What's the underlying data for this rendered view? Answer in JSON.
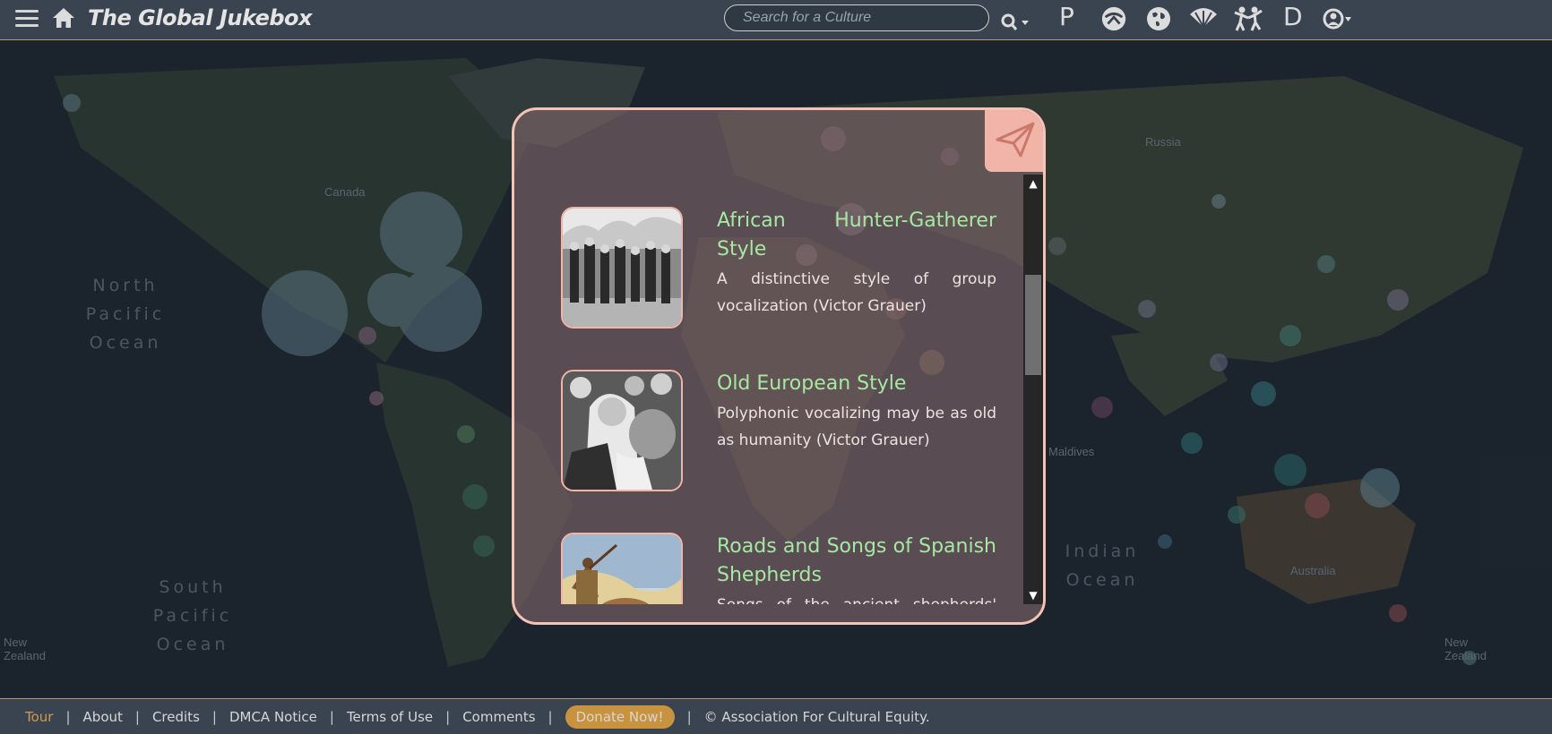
{
  "header": {
    "title": "The Global Jukebox",
    "search_placeholder": "Search for a Culture",
    "icons": [
      "menu-icon",
      "home-icon",
      "search-icon",
      "letter-p",
      "parlametrics-icon",
      "globe-icon",
      "fan-icon",
      "dancers-icon",
      "letter-d",
      "account-icon"
    ],
    "letter_p": "P",
    "letter_d": "D"
  },
  "map": {
    "ocean_labels": [
      "North Pacific Ocean",
      "South Pacific Ocean",
      "Indian Ocean"
    ],
    "places": [
      "Canada",
      "Russia",
      "Maldives",
      "Australia",
      "New Zealand",
      "New Zealand"
    ]
  },
  "modal": {
    "items": [
      {
        "title": "African Hunter-Gatherer Style",
        "description": "A distinctive style of group vocalization (Victor Grauer)"
      },
      {
        "title": "Old European Style",
        "description": "Polyphonic vocalizing may be as old as humanity (Victor Grauer)"
      },
      {
        "title": "Roads and Songs of Spanish Shepherds",
        "description": "Songs of the ancient shepherds' roads"
      }
    ]
  },
  "footer": {
    "links": [
      "Tour",
      "About",
      "Credits",
      "DMCA Notice",
      "Terms of Use",
      "Comments"
    ],
    "donate": "Donate Now!",
    "copyright": "© Association For Cultural Equity."
  },
  "colors": {
    "accent": "#c9923f",
    "title_green": "#a6e8a2",
    "modal_border": "#f4c2b7"
  }
}
